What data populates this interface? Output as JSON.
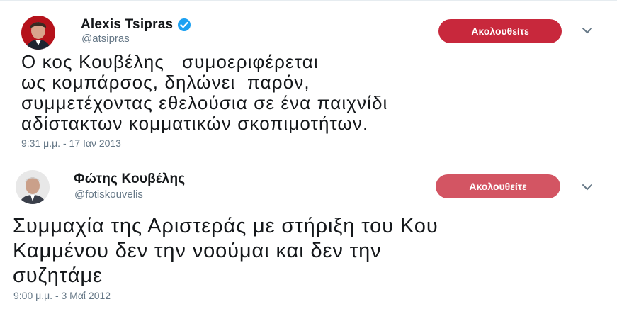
{
  "tweets": [
    {
      "display_name": "Alexis Tsipras",
      "handle": "@atsipras",
      "verified": true,
      "follow_label": "Ακολουθείτε",
      "text_lines": [
        "Ο κος Κουβέλης   συμοεριφέρεται",
        "ως κομπάρσος, δηλώνει  παρόν,",
        "συμμετέχοντας εθελούσια σε ένα παιχνίδι",
        "αδίστακτων κομματικών σκοπιμοτήτων."
      ],
      "timestamp": "9:31 μ.μ. - 17 Ιαν 2013",
      "icons": {
        "verified": "verified-badge-icon",
        "menu": "chevron-down-icon"
      }
    },
    {
      "display_name": "Φώτης Κουβέλης",
      "handle": "@fotiskouvelis",
      "verified": false,
      "follow_label": "Ακολουθείτε",
      "text_lines": [
        "Συμμαχία της Αριστεράς με στήριξη του Κου",
        "Καμμένου δεν την νοούμαι και δεν την",
        "συζητάμε"
      ],
      "timestamp": "9:00 μ.μ. - 3 Μαΐ 2012",
      "icons": {
        "menu": "chevron-down-icon"
      }
    }
  ],
  "colors": {
    "follow_button_1": "#c8283c",
    "follow_button_2": "#d35563",
    "verified": "#1da1f2",
    "secondary_text": "#657786",
    "chevron": "#657786"
  }
}
